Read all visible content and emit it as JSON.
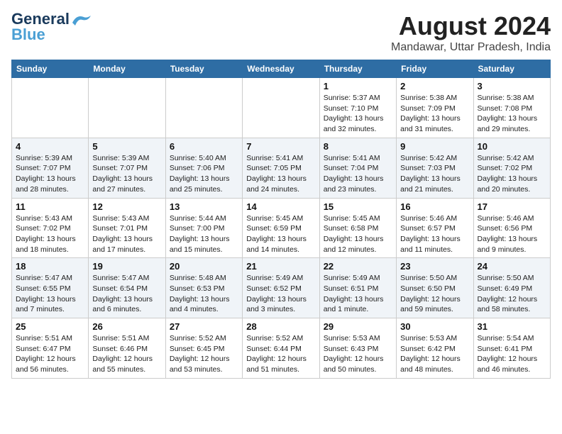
{
  "logo": {
    "line1": "General",
    "line2": "Blue"
  },
  "title": "August 2024",
  "subtitle": "Mandawar, Uttar Pradesh, India",
  "days_header": [
    "Sunday",
    "Monday",
    "Tuesday",
    "Wednesday",
    "Thursday",
    "Friday",
    "Saturday"
  ],
  "weeks": [
    [
      {
        "day": "",
        "info": ""
      },
      {
        "day": "",
        "info": ""
      },
      {
        "day": "",
        "info": ""
      },
      {
        "day": "",
        "info": ""
      },
      {
        "day": "1",
        "info": "Sunrise: 5:37 AM\nSunset: 7:10 PM\nDaylight: 13 hours\nand 32 minutes."
      },
      {
        "day": "2",
        "info": "Sunrise: 5:38 AM\nSunset: 7:09 PM\nDaylight: 13 hours\nand 31 minutes."
      },
      {
        "day": "3",
        "info": "Sunrise: 5:38 AM\nSunset: 7:08 PM\nDaylight: 13 hours\nand 29 minutes."
      }
    ],
    [
      {
        "day": "4",
        "info": "Sunrise: 5:39 AM\nSunset: 7:07 PM\nDaylight: 13 hours\nand 28 minutes."
      },
      {
        "day": "5",
        "info": "Sunrise: 5:39 AM\nSunset: 7:07 PM\nDaylight: 13 hours\nand 27 minutes."
      },
      {
        "day": "6",
        "info": "Sunrise: 5:40 AM\nSunset: 7:06 PM\nDaylight: 13 hours\nand 25 minutes."
      },
      {
        "day": "7",
        "info": "Sunrise: 5:41 AM\nSunset: 7:05 PM\nDaylight: 13 hours\nand 24 minutes."
      },
      {
        "day": "8",
        "info": "Sunrise: 5:41 AM\nSunset: 7:04 PM\nDaylight: 13 hours\nand 23 minutes."
      },
      {
        "day": "9",
        "info": "Sunrise: 5:42 AM\nSunset: 7:03 PM\nDaylight: 13 hours\nand 21 minutes."
      },
      {
        "day": "10",
        "info": "Sunrise: 5:42 AM\nSunset: 7:02 PM\nDaylight: 13 hours\nand 20 minutes."
      }
    ],
    [
      {
        "day": "11",
        "info": "Sunrise: 5:43 AM\nSunset: 7:02 PM\nDaylight: 13 hours\nand 18 minutes."
      },
      {
        "day": "12",
        "info": "Sunrise: 5:43 AM\nSunset: 7:01 PM\nDaylight: 13 hours\nand 17 minutes."
      },
      {
        "day": "13",
        "info": "Sunrise: 5:44 AM\nSunset: 7:00 PM\nDaylight: 13 hours\nand 15 minutes."
      },
      {
        "day": "14",
        "info": "Sunrise: 5:45 AM\nSunset: 6:59 PM\nDaylight: 13 hours\nand 14 minutes."
      },
      {
        "day": "15",
        "info": "Sunrise: 5:45 AM\nSunset: 6:58 PM\nDaylight: 13 hours\nand 12 minutes."
      },
      {
        "day": "16",
        "info": "Sunrise: 5:46 AM\nSunset: 6:57 PM\nDaylight: 13 hours\nand 11 minutes."
      },
      {
        "day": "17",
        "info": "Sunrise: 5:46 AM\nSunset: 6:56 PM\nDaylight: 13 hours\nand 9 minutes."
      }
    ],
    [
      {
        "day": "18",
        "info": "Sunrise: 5:47 AM\nSunset: 6:55 PM\nDaylight: 13 hours\nand 7 minutes."
      },
      {
        "day": "19",
        "info": "Sunrise: 5:47 AM\nSunset: 6:54 PM\nDaylight: 13 hours\nand 6 minutes."
      },
      {
        "day": "20",
        "info": "Sunrise: 5:48 AM\nSunset: 6:53 PM\nDaylight: 13 hours\nand 4 minutes."
      },
      {
        "day": "21",
        "info": "Sunrise: 5:49 AM\nSunset: 6:52 PM\nDaylight: 13 hours\nand 3 minutes."
      },
      {
        "day": "22",
        "info": "Sunrise: 5:49 AM\nSunset: 6:51 PM\nDaylight: 13 hours\nand 1 minute."
      },
      {
        "day": "23",
        "info": "Sunrise: 5:50 AM\nSunset: 6:50 PM\nDaylight: 12 hours\nand 59 minutes."
      },
      {
        "day": "24",
        "info": "Sunrise: 5:50 AM\nSunset: 6:49 PM\nDaylight: 12 hours\nand 58 minutes."
      }
    ],
    [
      {
        "day": "25",
        "info": "Sunrise: 5:51 AM\nSunset: 6:47 PM\nDaylight: 12 hours\nand 56 minutes."
      },
      {
        "day": "26",
        "info": "Sunrise: 5:51 AM\nSunset: 6:46 PM\nDaylight: 12 hours\nand 55 minutes."
      },
      {
        "day": "27",
        "info": "Sunrise: 5:52 AM\nSunset: 6:45 PM\nDaylight: 12 hours\nand 53 minutes."
      },
      {
        "day": "28",
        "info": "Sunrise: 5:52 AM\nSunset: 6:44 PM\nDaylight: 12 hours\nand 51 minutes."
      },
      {
        "day": "29",
        "info": "Sunrise: 5:53 AM\nSunset: 6:43 PM\nDaylight: 12 hours\nand 50 minutes."
      },
      {
        "day": "30",
        "info": "Sunrise: 5:53 AM\nSunset: 6:42 PM\nDaylight: 12 hours\nand 48 minutes."
      },
      {
        "day": "31",
        "info": "Sunrise: 5:54 AM\nSunset: 6:41 PM\nDaylight: 12 hours\nand 46 minutes."
      }
    ]
  ]
}
